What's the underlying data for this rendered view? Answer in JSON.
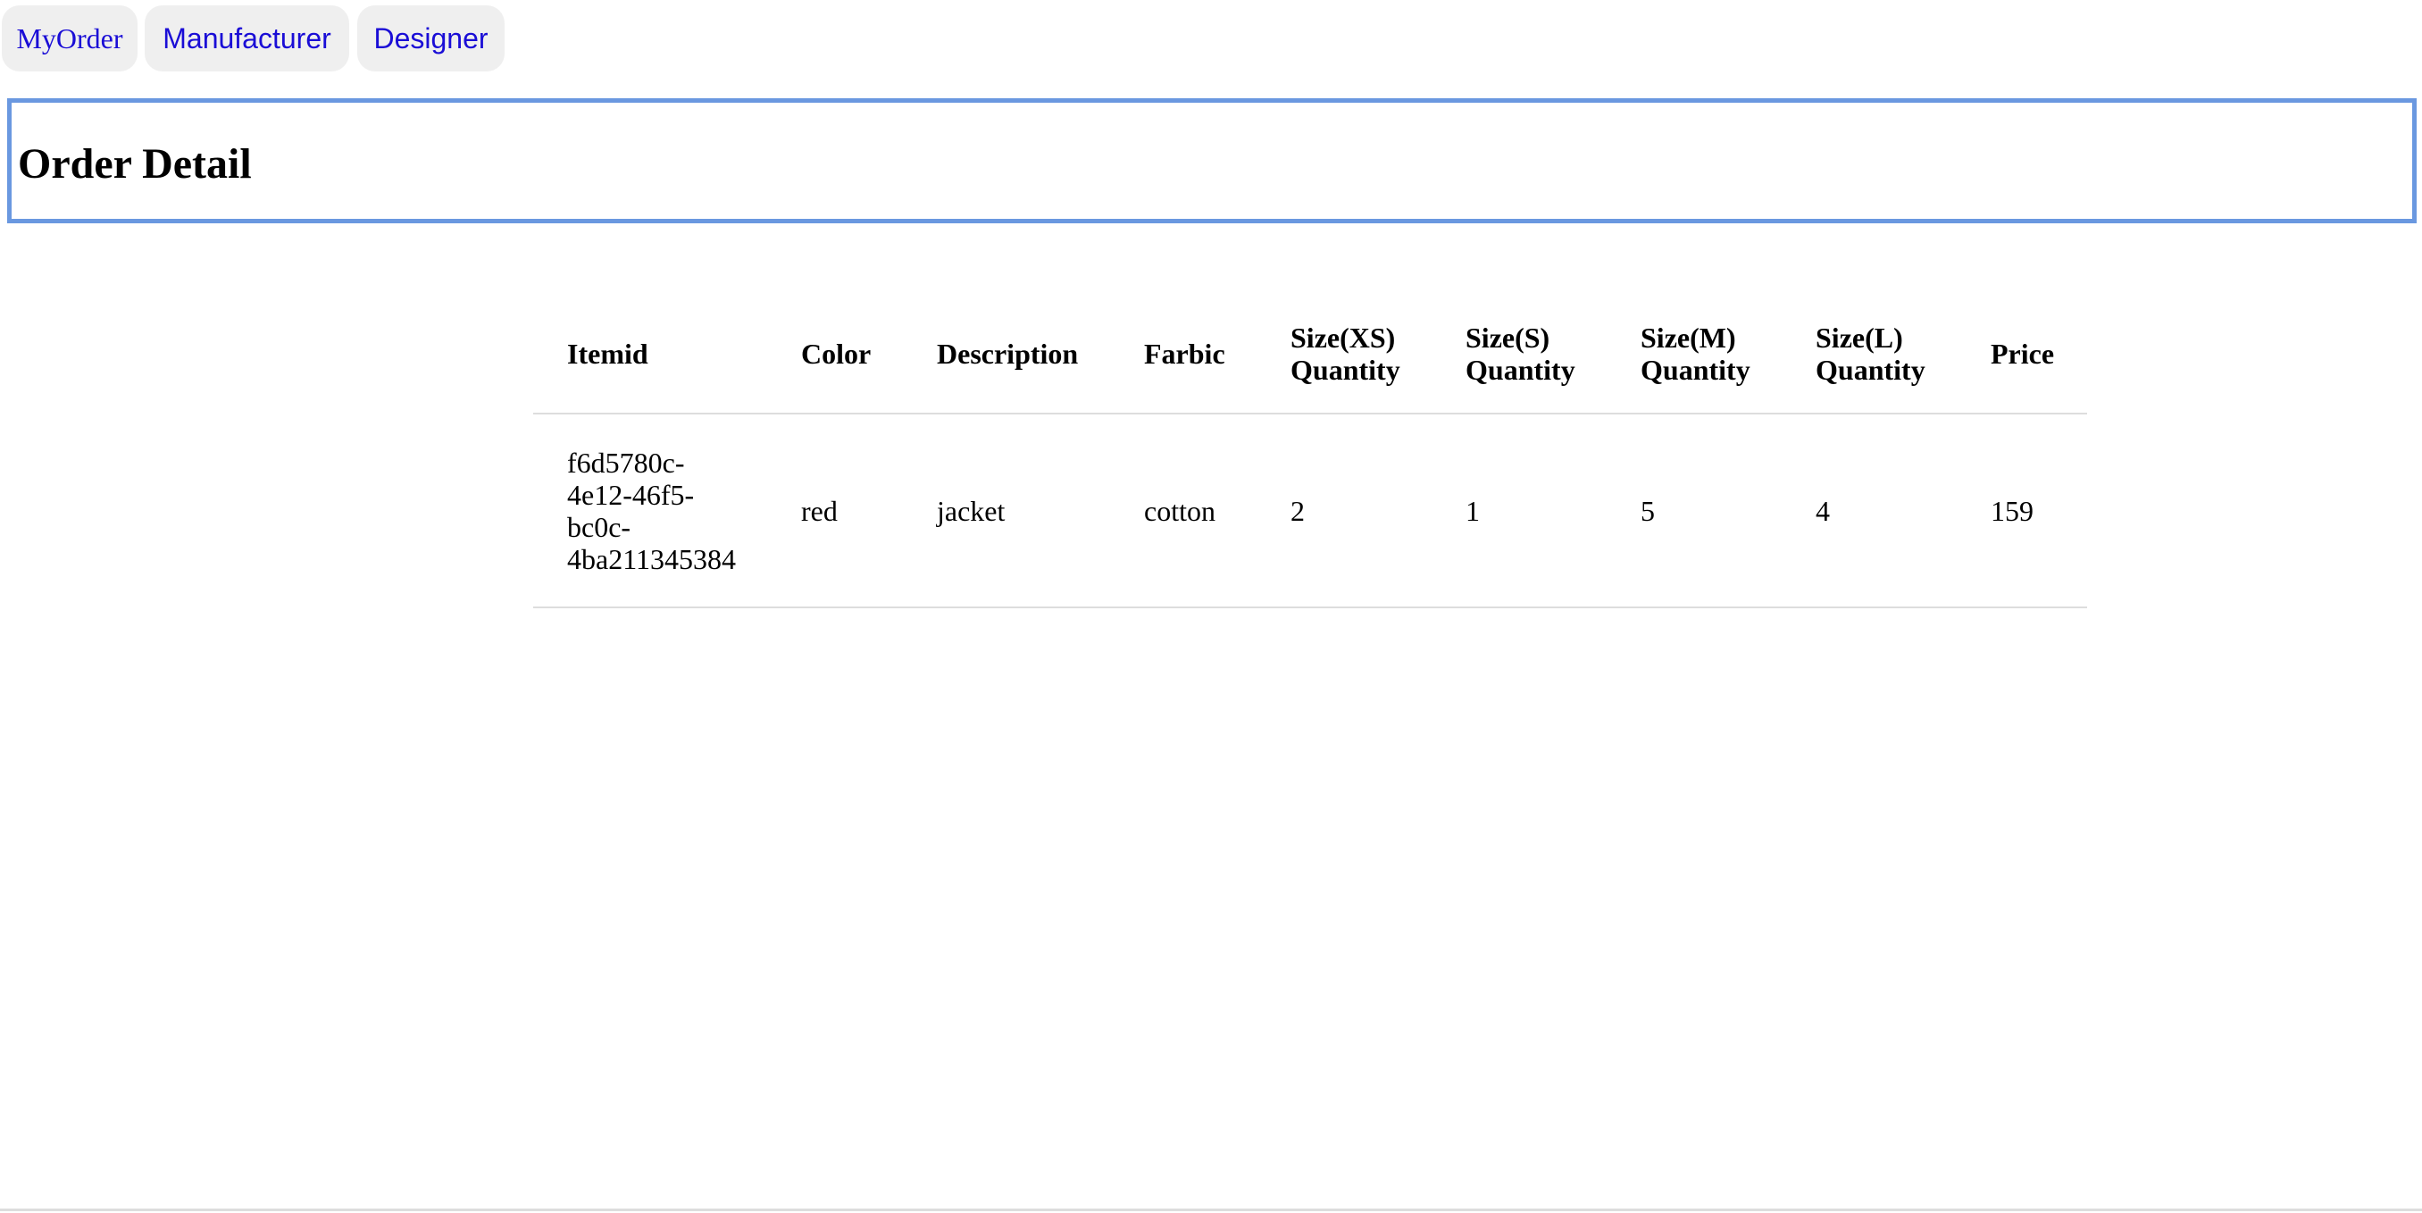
{
  "nav": {
    "myorder": "MyOrder",
    "manufacturer": "Manufacturer",
    "designer": "Designer"
  },
  "header": {
    "title": "Order Detail"
  },
  "table": {
    "headers": {
      "itemid": "Itemid",
      "color": "Color",
      "description": "Description",
      "fabric": "Farbic",
      "xs": [
        "Size(XS)",
        "Quantity"
      ],
      "s": [
        "Size(S)",
        "Quantity"
      ],
      "m": [
        "Size(M)",
        "Quantity"
      ],
      "l": [
        "Size(L)",
        "Quantity"
      ],
      "price": "Price"
    },
    "rows": [
      {
        "itemid_lines": [
          "f6d5780c-",
          "4e12-46f5-",
          "bc0c-",
          "4ba211345384"
        ],
        "color": "red",
        "description": "jacket",
        "fabric": "cotton",
        "xs": "2",
        "s": "1",
        "m": "5",
        "l": "4",
        "price": "159"
      }
    ]
  }
}
